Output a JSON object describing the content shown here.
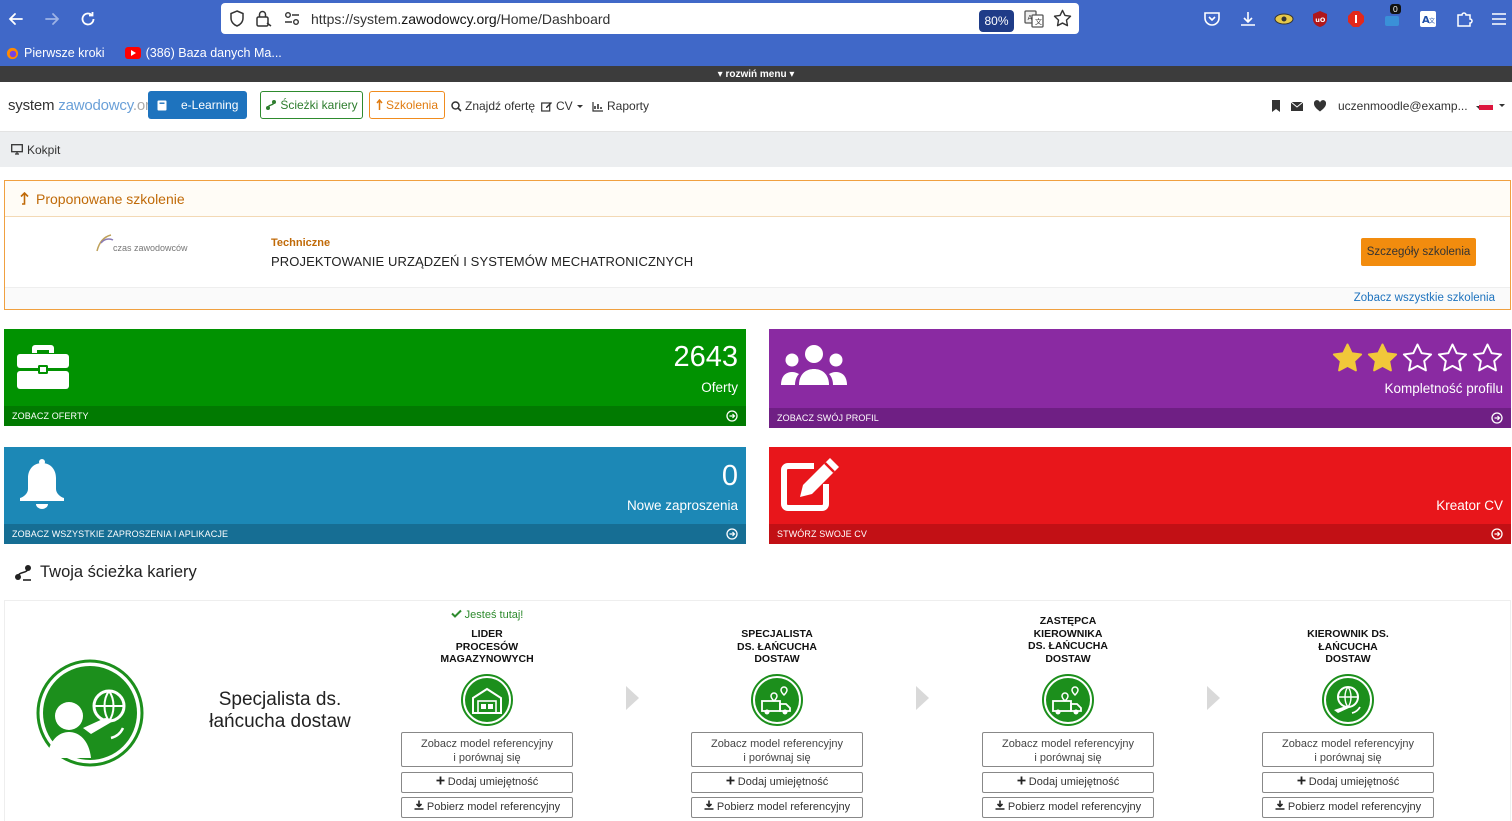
{
  "browser": {
    "url_prefix": "https://system.",
    "url_domain": "zawodowcy.org",
    "url_path": "/Home/Dashboard",
    "zoom": "80%",
    "bookmarks": [
      "Pierwsze kroki",
      "(386) Baza danych Ma..."
    ],
    "ext_badge": "0"
  },
  "expand_menu": "▾ rozwiń menu ▾",
  "header": {
    "logo_a": "system ",
    "logo_b": "zawodowcy",
    "logo_c": ".org",
    "elearning": "e-Learning",
    "sciezki": "Ścieżki kariery",
    "szkolenia": "Szkolenia",
    "znajdz": "Znajdź ofertę",
    "cv": "CV",
    "raporty": "Raporty",
    "user": "uczenmoodle@examp..."
  },
  "breadcrumb": "Kokpit",
  "proposed": {
    "heading": "Proponowane szkolenie",
    "logo_text": "czas zawodowców",
    "category": "Techniczne",
    "title": "PROJEKTOWANIE URZĄDZEŃ I SYSTEMÓW MECHATRONICZNYCH",
    "details_button": "Szczegóły szkolenia",
    "see_all": "Zobacz wszystkie szkolenia"
  },
  "tiles": {
    "offers": {
      "count": "2643",
      "label": "Oferty",
      "footer": "ZOBACZ OFERTY",
      "color": "#019201",
      "foot_color": "#017a01"
    },
    "profile": {
      "label": "Kompletność profilu",
      "footer": "ZOBACZ SWÓJ PROFIL",
      "stars_filled": 2,
      "stars_total": 5,
      "color": "#8a2aa2",
      "foot_color": "#6f1f84"
    },
    "invites": {
      "count": "0",
      "label": "Nowe zaproszenia",
      "footer": "ZOBACZ WSZYSTKIE ZAPROSZENIA I APLIKACJE",
      "color": "#1c88b6",
      "foot_color": "#166e94"
    },
    "cv": {
      "label": "Kreator CV",
      "footer": "STWÓRZ SWOJE CV",
      "color": "#e8161b",
      "foot_color": "#c21015"
    }
  },
  "career": {
    "heading": "Twoja ścieżka kariery",
    "current_line1": "Specjalista ds.",
    "current_line2": "łańcucha dostaw",
    "you_are_here": "Jesteś tutaj!",
    "btn_ref_line1": "Zobacz model referencyjny",
    "btn_ref_line2": "i porównaj się",
    "btn_add": "Dodaj umiejętność",
    "btn_dl": "Pobierz model referencyjny",
    "steps": [
      {
        "lines": [
          "LIDER",
          "PROCESÓW",
          "MAGAZYNOWYCH"
        ],
        "icon": "warehouse-icon"
      },
      {
        "lines": [
          "SPECJALISTA",
          "DS. ŁAŃCUCHA",
          "DOSTAW"
        ],
        "icon": "delivery-truck-icon"
      },
      {
        "lines": [
          "ZASTĘPCA",
          "KIEROWNIKA",
          "DS. ŁAŃCUCHA",
          "DOSTAW"
        ],
        "icon": "delivery-truck-icon"
      },
      {
        "lines": [
          "KIEROWNIK DS.",
          "ŁAŃCUCHA",
          "DOSTAW"
        ],
        "icon": "global-logistics-icon"
      }
    ]
  }
}
